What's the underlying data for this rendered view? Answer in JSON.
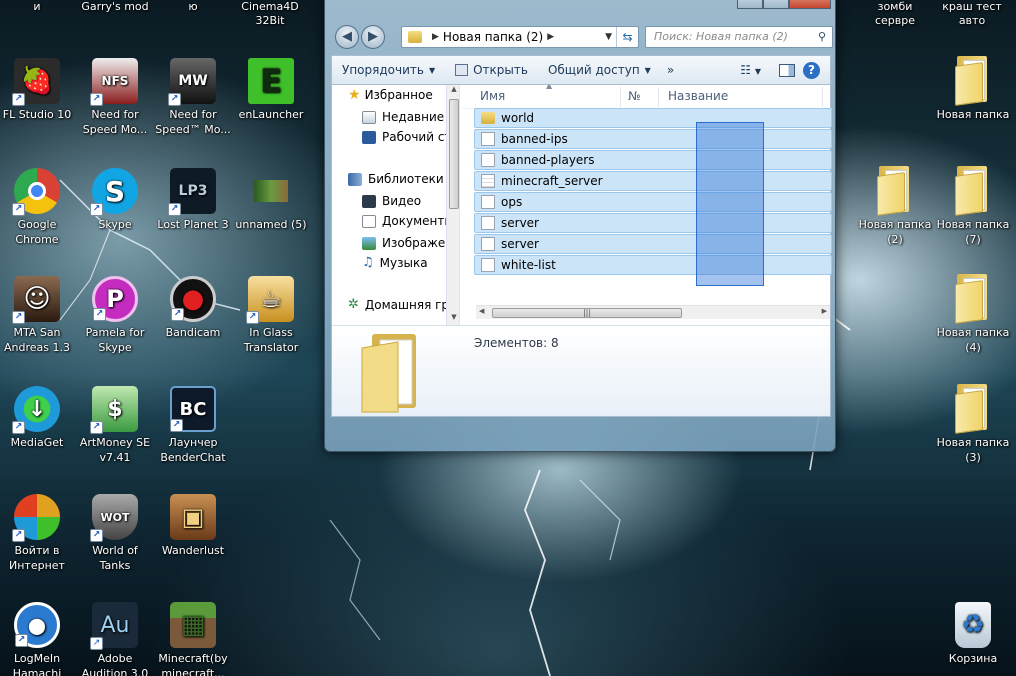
{
  "top_captions": [
    {
      "id": "cap-i",
      "text": "и"
    },
    {
      "id": "cap-garrys",
      "text": "Garry's mod"
    },
    {
      "id": "cap-yu",
      "text": "ю"
    },
    {
      "id": "cap-cinema",
      "text": "Cinema4D\n32Bit"
    },
    {
      "id": "cap-zombi",
      "text": "зомби\nсервре"
    },
    {
      "id": "cap-krash",
      "text": "краш тест\nавто"
    }
  ],
  "desktop_icons": [
    {
      "label": "FL Studio 10",
      "icon": "fl-studio-icon",
      "color": "#e8a21a"
    },
    {
      "label": "Need for Speed Mo...",
      "icon": "need-for-speed-icon",
      "color": "#8b1d1d"
    },
    {
      "label": "Need for Speed™ Mo...",
      "icon": "need-for-speed-mw-icon",
      "color": "#3a3a3a"
    },
    {
      "label": "enLauncher",
      "icon": "enlauncher-icon",
      "color": "#3fbf2a"
    },
    {
      "label": "Google Chrome",
      "icon": "chrome-icon",
      "color": "#d94135"
    },
    {
      "label": "Skype",
      "icon": "skype-icon",
      "color": "#12a5e4"
    },
    {
      "label": "Lost Planet 3",
      "icon": "lost-planet-icon",
      "color": "#1a2a3a"
    },
    {
      "label": "unnamed (5)",
      "icon": "unnamed-icon",
      "color": "#4a7a30"
    },
    {
      "label": "MTA San Andreas 1.3",
      "icon": "mta-icon",
      "color": "#5a4030"
    },
    {
      "label": "Pamela for Skype",
      "icon": "pamela-icon",
      "color": "#c42cc0"
    },
    {
      "label": "Bandicam",
      "icon": "bandicam-icon",
      "color": "#222222"
    },
    {
      "label": "In Glass Translator",
      "icon": "translator-icon",
      "color": "#d8a830"
    },
    {
      "label": "MediaGet",
      "icon": "mediaget-icon",
      "color": "#1e9ad8"
    },
    {
      "label": "ArtMoney SE v7.41",
      "icon": "artmoney-icon",
      "color": "#3a9a40"
    },
    {
      "label": "Лаунчер BenderChat",
      "icon": "benderchat-icon",
      "color": "#203050"
    },
    {
      "label": "Войти в Интернет",
      "icon": "internet-icon",
      "color": "#e0a020"
    },
    {
      "label": "World of Tanks",
      "icon": "world-of-tanks-icon",
      "color": "#555555"
    },
    {
      "label": "Wanderlust",
      "icon": "wanderlust-icon",
      "color": "#8a5a2a"
    },
    {
      "label": "LogMeIn Hamachi",
      "icon": "hamachi-icon",
      "color": "#2a7ad0"
    },
    {
      "label": "Adobe Audition 3.0",
      "icon": "audition-icon",
      "color": "#1a2a3a"
    },
    {
      "label": "Minecraft(by minecraft...",
      "icon": "minecraft-icon",
      "color": "#5a8a3a"
    }
  ],
  "glyphs": {
    "fl": "🍓",
    "nfs": "NFS",
    "nfsmw": "MW",
    "en": "E",
    "chrome": "●",
    "skype": "S",
    "lp3": "LP3",
    "mta": "☺",
    "pamela": "P",
    "bandicam": "●",
    "translator": "☕",
    "mediaget": "↓",
    "artmoney": "$",
    "bc": "BC",
    "wot": "WOT",
    "wander": "▣",
    "hamachi": "⬤",
    "audition": "Au",
    "minecraft": "▦",
    "recycle": "♻",
    "shortcut": "↗"
  },
  "right_icons": [
    {
      "label": "Новая папка"
    },
    {
      "label": "Новая папка (2)"
    },
    {
      "label": "Новая папка (7)"
    },
    {
      "label": "Новая папка (4)"
    },
    {
      "label": "Новая папка (3)"
    },
    {
      "label": "Корзина"
    }
  ],
  "window": {
    "address_path": "Новая папка (2)",
    "search_placeholder": "Поиск: Новая папка (2)",
    "toolbar": {
      "organize": "Упорядочить",
      "open": "Открыть",
      "share": "Общий доступ",
      "more": "»"
    },
    "nav_items": [
      {
        "label": "Избранное",
        "icon": "favorites-star-icon"
      },
      {
        "label": "Недавние места",
        "icon": "recent-places-icon"
      },
      {
        "label": "Рабочий стол",
        "icon": "desktop-icon"
      },
      {
        "label": "Библиотеки",
        "icon": "libraries-icon"
      },
      {
        "label": "Видео",
        "icon": "video-icon"
      },
      {
        "label": "Документы",
        "icon": "documents-icon"
      },
      {
        "label": "Изображения",
        "icon": "pictures-icon"
      },
      {
        "label": "Музыка",
        "icon": "music-icon"
      },
      {
        "label": "Домашняя группа",
        "icon": "homegroup-icon"
      }
    ],
    "columns": {
      "name": "Имя",
      "number": "№",
      "title": "Название"
    },
    "files": [
      {
        "name": "world",
        "type": "folder"
      },
      {
        "name": "banned-ips",
        "type": "text"
      },
      {
        "name": "banned-players",
        "type": "text"
      },
      {
        "name": "minecraft_server",
        "type": "exe"
      },
      {
        "name": "ops",
        "type": "text"
      },
      {
        "name": "server",
        "type": "text"
      },
      {
        "name": "server",
        "type": "text"
      },
      {
        "name": "white-list",
        "type": "text"
      }
    ],
    "status": "Элементов: 8"
  }
}
